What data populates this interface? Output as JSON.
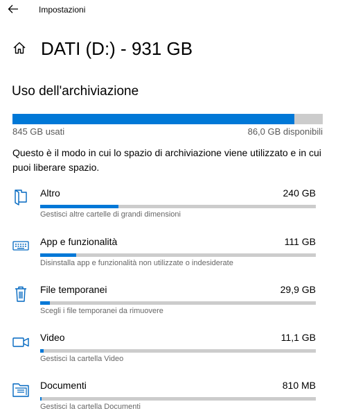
{
  "header": {
    "title": "Impostazioni"
  },
  "page": {
    "title": "DATI (D:) - 931 GB"
  },
  "storage": {
    "section_title": "Uso dell'archiviazione",
    "used": "845 GB usati",
    "free": "86,0 GB disponibili",
    "used_fraction": 0.908,
    "description": "Questo è il modo in cui lo spazio di archiviazione viene utilizzato e in cui puoi liberare spazio."
  },
  "categories": [
    {
      "name": "Altro",
      "size": "240 GB",
      "description": "Gestisci altre cartelle di grandi dimensioni",
      "fraction": 0.284,
      "icon": "folder-icon"
    },
    {
      "name": "App e funzionalità",
      "size": "111 GB",
      "description": "Disinstalla app e funzionalità non utilizzate o indesiderate",
      "fraction": 0.131,
      "icon": "keyboard-icon"
    },
    {
      "name": "File temporanei",
      "size": "29,9 GB",
      "description": "Scegli i file temporanei da rimuovere",
      "fraction": 0.035,
      "icon": "trash-icon"
    },
    {
      "name": "Video",
      "size": "11,1 GB",
      "description": "Gestisci la cartella Video",
      "fraction": 0.013,
      "icon": "video-camera-icon"
    },
    {
      "name": "Documenti",
      "size": "810 MB",
      "description": "Gestisci la cartella Documenti",
      "fraction": 0.001,
      "icon": "documents-folder-icon"
    }
  ],
  "colors": {
    "accent": "#0078d7",
    "track": "#cccccc",
    "secondary_text": "#666666"
  }
}
